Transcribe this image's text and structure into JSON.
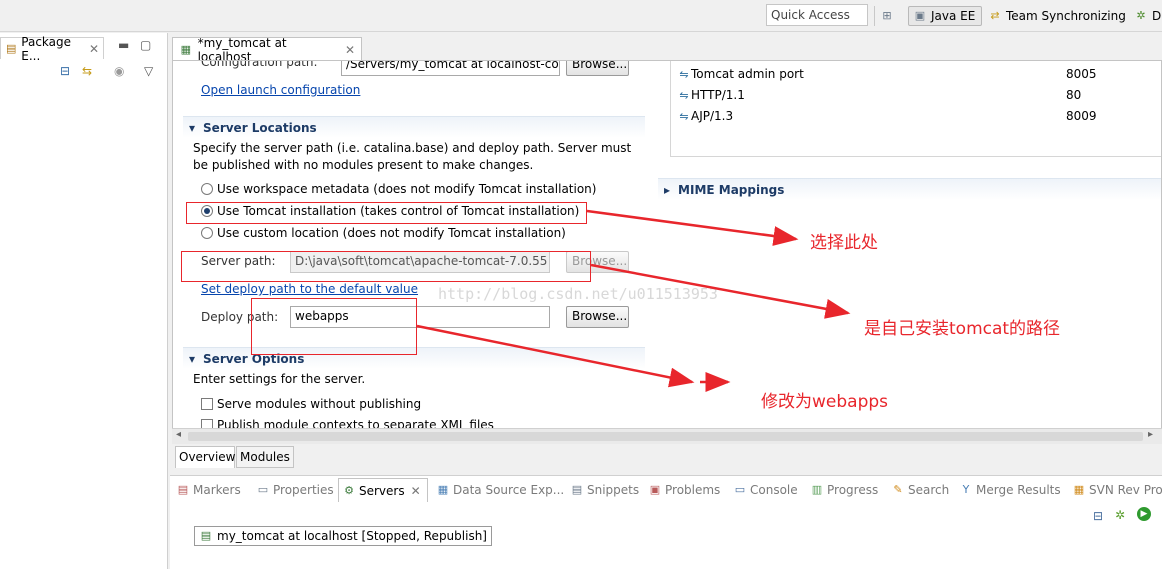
{
  "toolbar": {
    "quick_access": "Quick Access",
    "perspectives": [
      "Java EE",
      "Team Synchronizing",
      "D"
    ]
  },
  "left_panel": {
    "tab_label": "Package E..."
  },
  "editor": {
    "tab_label": "*my_tomcat at localhost",
    "config_path_label": "Configuration path:",
    "config_path_value": "/Servers/my_tomcat at localhost-con",
    "browse_label": "Browse...",
    "open_launch_config": "Open launch configuration",
    "server_locations": {
      "title": "Server Locations",
      "description": "Specify the server path (i.e. catalina.base) and deploy path. Server must be published with no modules present to make changes.",
      "options": [
        "Use workspace metadata (does not modify Tomcat installation)",
        "Use Tomcat installation (takes control of Tomcat installation)",
        "Use custom location (does not modify Tomcat installation)"
      ],
      "selected_index": 1,
      "server_path_label": "Server path:",
      "server_path_value": "D:\\java\\soft\\tomcat\\apache-tomcat-7.0.55",
      "set_deploy_default": "Set deploy path to the default value",
      "deploy_path_label": "Deploy path:",
      "deploy_path_value": "webapps"
    },
    "server_options": {
      "title": "Server Options",
      "description": "Enter settings for the server.",
      "checkboxes": [
        "Serve modules without publishing",
        "Publish module contexts to separate XML files"
      ]
    },
    "ports": [
      {
        "name": "Tomcat admin port",
        "value": "8005"
      },
      {
        "name": "HTTP/1.1",
        "value": "80"
      },
      {
        "name": "AJP/1.3",
        "value": "8009"
      }
    ],
    "mime_mappings": "MIME Mappings",
    "bottom_tabs": [
      "Overview",
      "Modules"
    ]
  },
  "views": {
    "tabs": [
      "Markers",
      "Properties",
      "Servers",
      "Data Source Exp...",
      "Snippets",
      "Problems",
      "Console",
      "Progress",
      "Search",
      "Merge Results",
      "SVN Rev Pro"
    ],
    "active": "Servers",
    "server_entry": "my_tomcat at localhost  [Stopped, Republish]"
  },
  "annotations": {
    "select_here": "选择此处",
    "tomcat_path": "是自己安装tomcat的路径",
    "change_webapps": "修改为webapps",
    "watermark": "http://blog.csdn.net/u011513953"
  },
  "colors": {
    "annotation": "#e8262c",
    "link": "#0645ad",
    "section_title": "#1d3b66"
  }
}
